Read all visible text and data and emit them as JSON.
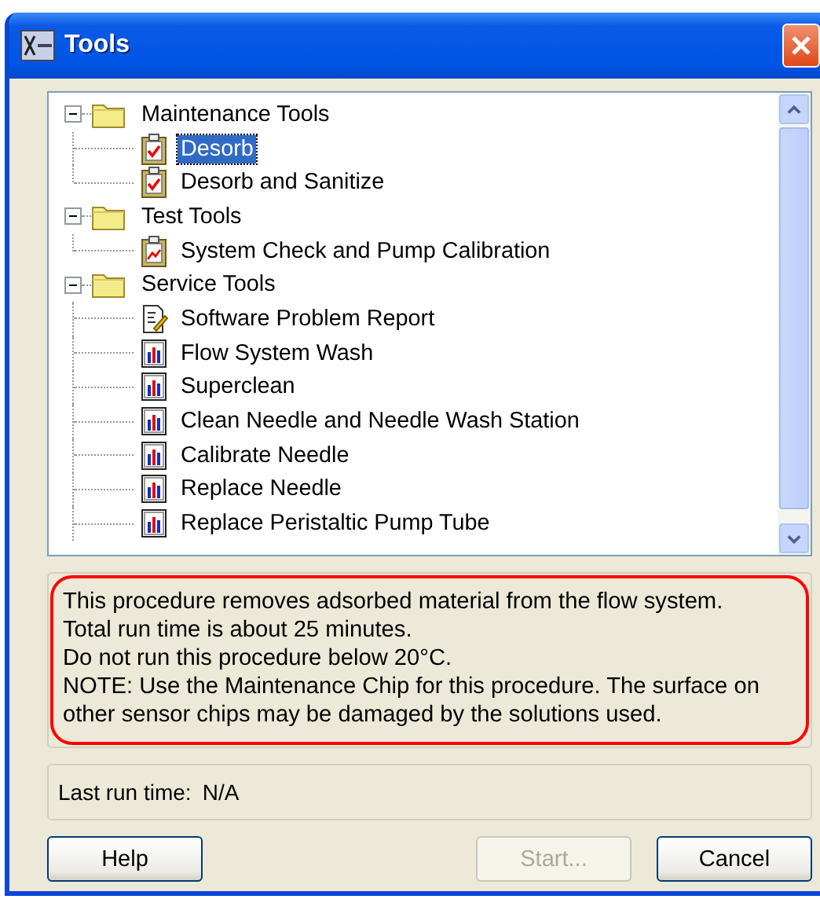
{
  "window": {
    "title": "Tools"
  },
  "tree": [
    {
      "label": "Maintenance Tools",
      "kind": "folder",
      "expanded": true,
      "children": [
        {
          "label": "Desorb",
          "kind": "check",
          "selected": true
        },
        {
          "label": "Desorb and Sanitize",
          "kind": "check",
          "selected": false
        }
      ]
    },
    {
      "label": "Test Tools",
      "kind": "folder",
      "expanded": true,
      "children": [
        {
          "label": "System Check and Pump Calibration",
          "kind": "test",
          "selected": false
        }
      ]
    },
    {
      "label": "Service Tools",
      "kind": "folder",
      "expanded": true,
      "children": [
        {
          "label": "Software Problem Report",
          "kind": "report",
          "selected": false
        },
        {
          "label": "Flow System Wash",
          "kind": "tool",
          "selected": false
        },
        {
          "label": "Superclean",
          "kind": "tool",
          "selected": false
        },
        {
          "label": "Clean Needle and Needle Wash Station",
          "kind": "tool",
          "selected": false
        },
        {
          "label": "Calibrate Needle",
          "kind": "tool",
          "selected": false
        },
        {
          "label": "Replace Needle",
          "kind": "tool",
          "selected": false
        },
        {
          "label": "Replace Peristaltic Pump Tube",
          "kind": "tool",
          "selected": false
        }
      ]
    }
  ],
  "description": [
    "This procedure removes adsorbed material from the flow system.",
    "Total run time is about 25 minutes.",
    "Do not run this procedure below 20°C.",
    "NOTE: Use the Maintenance Chip for this procedure. The surface on other sensor chips may be damaged by the solutions used."
  ],
  "last_run": {
    "label": "Last run time:",
    "value": "N/A"
  },
  "buttons": [
    {
      "label": "Help",
      "disabled": false
    },
    {
      "label": "Start...",
      "disabled": true
    },
    {
      "label": "Cancel",
      "disabled": false
    }
  ]
}
